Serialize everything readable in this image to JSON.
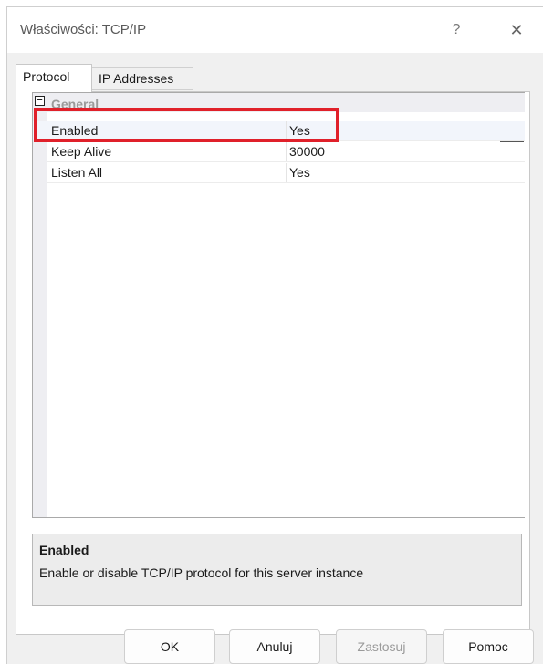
{
  "window": {
    "title": "Właściwości: TCP/IP",
    "help_glyph": "?",
    "close_glyph": "✕"
  },
  "tabs": [
    {
      "label": "Protocol",
      "active": true
    },
    {
      "label": "IP Addresses",
      "active": false
    }
  ],
  "grid": {
    "category": {
      "toggle_glyph": "−",
      "label": "General"
    },
    "rows": [
      {
        "name": "Enabled",
        "value": "Yes",
        "selected": true
      },
      {
        "name": "Keep Alive",
        "value": "30000",
        "selected": false
      },
      {
        "name": "Listen All",
        "value": "Yes",
        "selected": false
      }
    ]
  },
  "description": {
    "title": "Enabled",
    "text": "Enable or disable TCP/IP protocol for this server instance"
  },
  "buttons": {
    "ok": "OK",
    "cancel": "Anuluj",
    "apply": "Zastosuj",
    "help": "Pomoc"
  },
  "colors": {
    "highlight": "#e0202a",
    "window_bg": "#f0f0f0",
    "grid_gutter": "#eeeef2"
  }
}
